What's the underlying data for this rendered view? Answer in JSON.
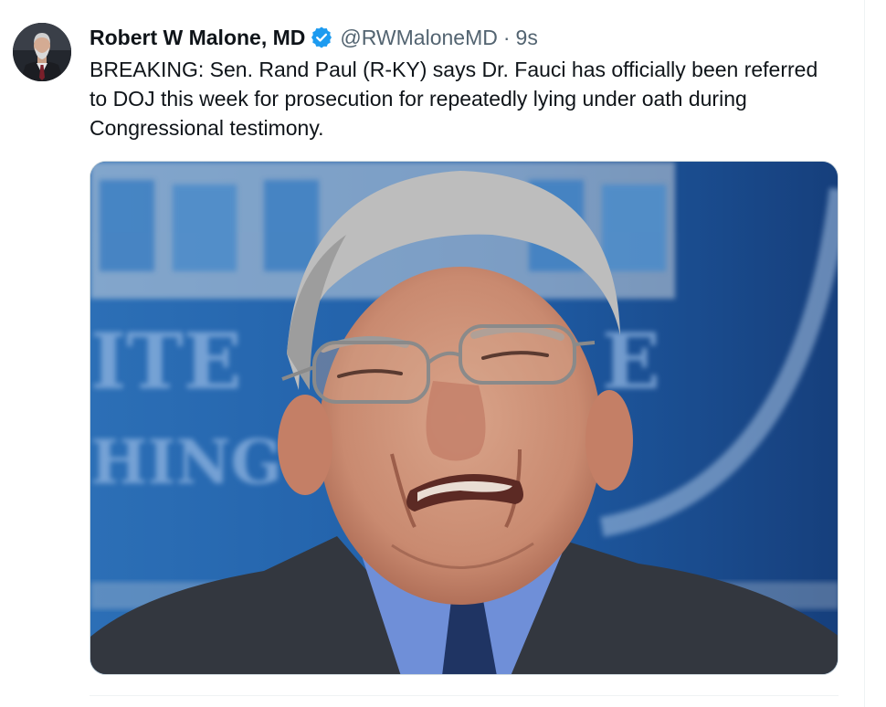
{
  "tweet": {
    "display_name": "Robert W Malone, MD",
    "handle": "@RWMaloneMD",
    "separator": "·",
    "timestamp": "9s",
    "text": "BREAKING: Sen. Rand Paul (R-KY) says Dr. Fauci has officially been referred to DOJ this week for prosecution for repeatedly lying under oath during Congressional testimony.",
    "verified_badge_color": "#1d9bf0",
    "media": {
      "background_text": [
        "ITE",
        "E",
        "HING"
      ]
    }
  },
  "icons": {
    "verified": "verified-badge-icon",
    "avatar": "profile-avatar"
  },
  "colors": {
    "text_primary": "#0f1419",
    "text_secondary": "#536471",
    "accent": "#1d9bf0",
    "divider": "#eff3f4"
  }
}
